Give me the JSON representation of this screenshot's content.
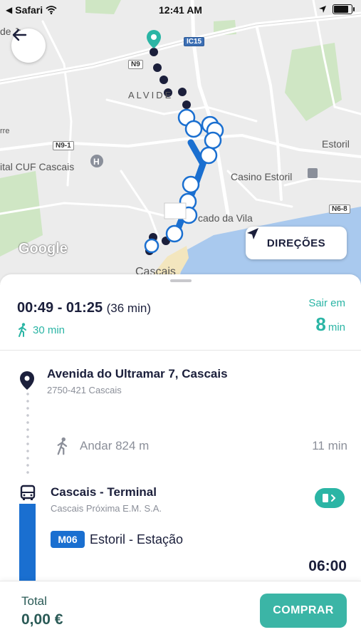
{
  "status_bar": {
    "carrier": "Safari",
    "time": "12:41 AM"
  },
  "map": {
    "labels": {
      "de_jus": "de Jus",
      "alvide": "ALVIDE",
      "estoril": "Estoril",
      "hospital": "ital CUF Cascais",
      "casino": "Casino Estoril",
      "cado_vila": "cado da Vila",
      "cascais": "Cascais",
      "rre": "rre"
    },
    "roads": {
      "ic15": "IC15",
      "n9": "N9",
      "n9_1": "N9-1",
      "n6_8": "N6-8"
    },
    "attribution": "Google"
  },
  "directions_button": {
    "label": "DIREÇÕES"
  },
  "trip": {
    "time_range": "00:49 - 01:25",
    "duration": "(36 min)",
    "walk_total": "30 min",
    "leave_label": "Sair em",
    "leave_value": "8",
    "leave_unit": "min"
  },
  "origin": {
    "title": "Avenida do Ultramar 7, Cascais",
    "subtitle": "2750-421 Cascais"
  },
  "walk_step": {
    "label": "Andar 824 m",
    "duration": "11 min"
  },
  "bus_stop": {
    "title": "Cascais - Terminal",
    "operator": "Cascais Próxima E.M. S.A.",
    "line": "M06",
    "destination": "Estoril - Estação",
    "departure": "06:00"
  },
  "footer": {
    "total_label": "Total",
    "total_value": "0,00 €",
    "buy_label": "COMPRAR"
  },
  "colors": {
    "teal": "#2bb5a5",
    "navy": "#1b1f3b",
    "bus_blue": "#1a6fd0"
  }
}
